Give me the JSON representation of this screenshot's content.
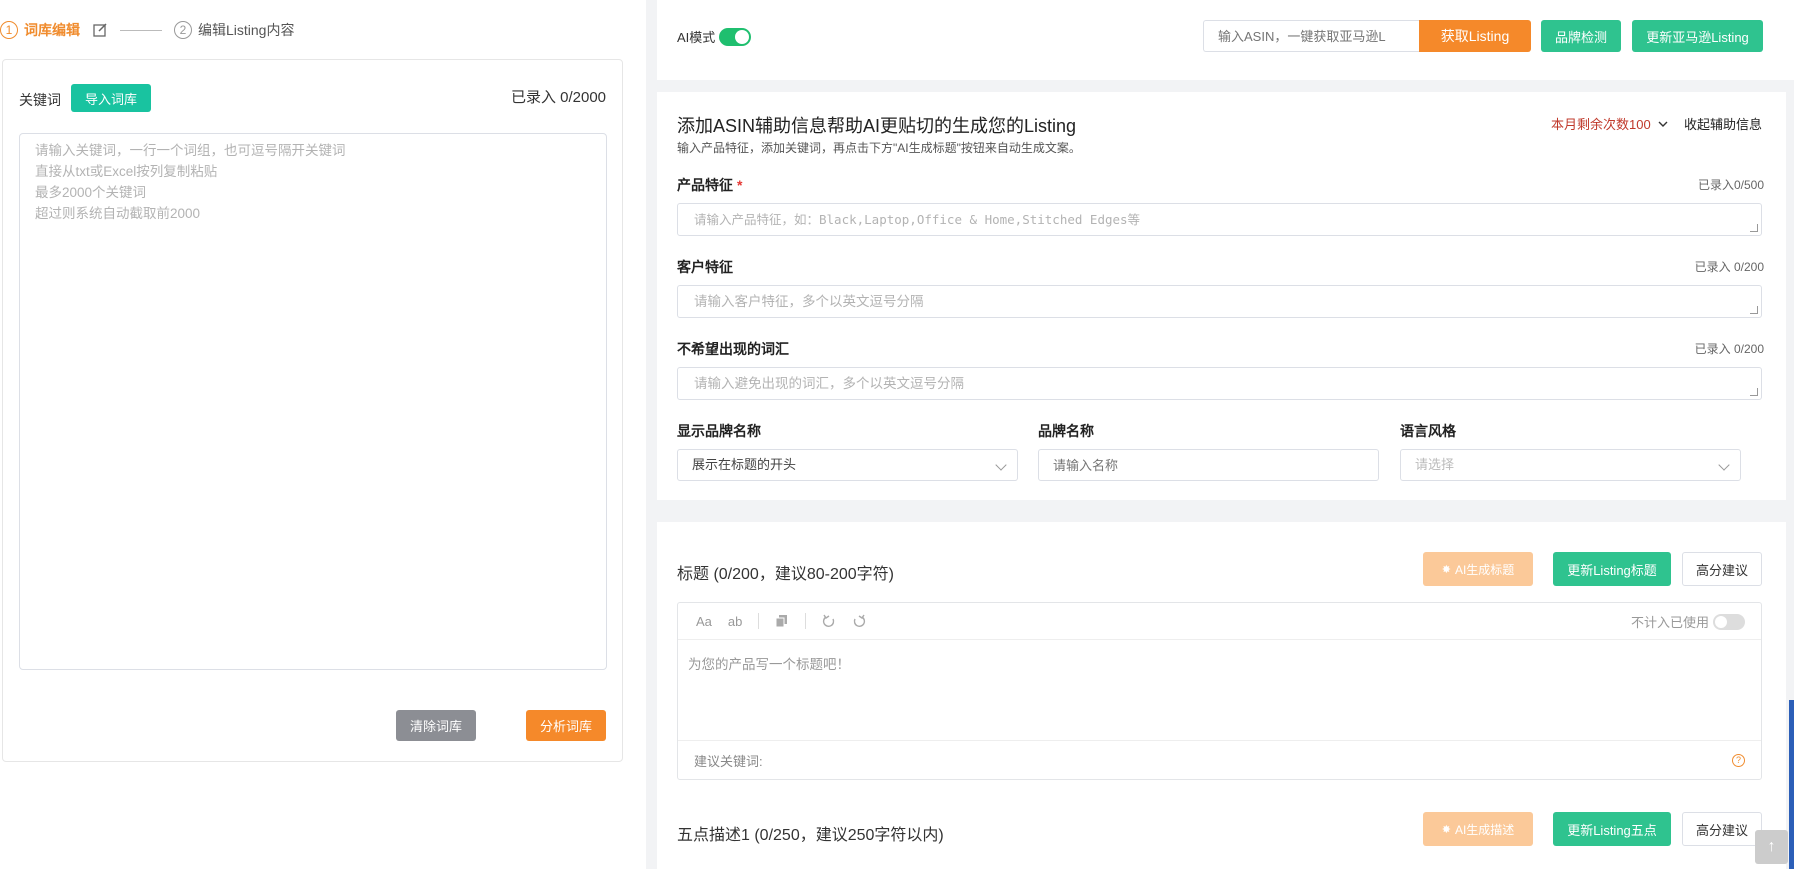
{
  "steps": [
    {
      "num": "1",
      "label": "词库编辑",
      "active": true
    },
    {
      "num": "2",
      "label": "编辑Listing内容",
      "active": false
    }
  ],
  "left": {
    "keyword_label": "关键词",
    "import_button": "导入词库",
    "count": "已录入 0/2000",
    "textarea_placeholder": "请输入关键词，一行一个词组，也可逗号隔开关键词\n直接从txt或Excel按列复制粘贴\n最多2000个关键词\n超过则系统自动截取前2000",
    "clear_button": "清除词库",
    "analyze_button": "分析词库"
  },
  "topbar": {
    "ai_mode_label": "AI模式",
    "ai_mode_on": true,
    "asin_placeholder": "输入ASIN，一键获取亚马逊L",
    "fetch_button": "获取Listing",
    "brand_check_button": "品牌检测",
    "update_amazon_button": "更新亚马逊Listing"
  },
  "assist": {
    "title": "添加ASIN辅助信息帮助AI更贴切的生成您的Listing",
    "subtitle": "输入产品特征，添加关键词，再点击下方\"AI生成标题\"按钮来自动生成文案。",
    "remaining": "本月剩余次数100",
    "collapse": "收起辅助信息",
    "product_feature": {
      "label": "产品特征",
      "required_mark": "*",
      "count": "已录入0/500",
      "placeholder": "请输入产品特征，如：Black,Laptop,Office & Home,Stitched Edges等"
    },
    "customer_feature": {
      "label": "客户特征",
      "count": "已录入 0/200",
      "placeholder": "请输入客户特征，多个以英文逗号分隔"
    },
    "unwanted_words": {
      "label": "不希望出现的词汇",
      "count": "已录入 0/200",
      "placeholder": "请输入避免出现的词汇，多个以英文逗号分隔"
    },
    "show_brand": {
      "label": "显示品牌名称",
      "value": "展示在标题的开头"
    },
    "brand_name": {
      "label": "品牌名称",
      "placeholder": "请输入名称"
    },
    "language_style": {
      "label": "语言风格",
      "placeholder": "请选择"
    }
  },
  "title_section": {
    "heading": "标题 (0/200，建议80-200字符)",
    "ai_button": "AI生成标题",
    "update_button": "更新Listing标题",
    "score_button": "高分建议",
    "toolbar": {
      "font": "Aa",
      "case": "ab"
    },
    "not_count_label": "不计入已使用",
    "placeholder": "为您的产品写一个标题吧！",
    "suggest_label": "建议关键词:",
    "help_icon": "?"
  },
  "bullet_section": {
    "heading": "五点描述1 (0/250，建议250字符以内)",
    "ai_button": "AI生成描述",
    "update_button": "更新Listing五点",
    "score_button": "高分建议"
  },
  "scroll_top_icon": "↑",
  "colors": {
    "accent_orange": "#f5892a",
    "green": "#2fc38f",
    "teal": "#19c3a0"
  }
}
